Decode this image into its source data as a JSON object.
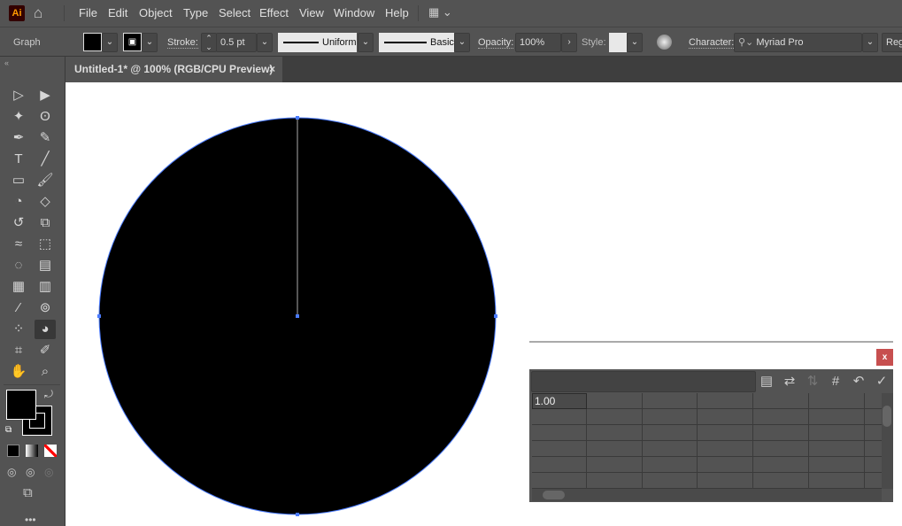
{
  "app": {
    "logo": "Ai",
    "menu": [
      "File",
      "Edit",
      "Object",
      "Type",
      "Select",
      "Effect",
      "View",
      "Window",
      "Help"
    ]
  },
  "control": {
    "selection_label": "Graph",
    "fill_color": "#000000",
    "stroke_label": "Stroke:",
    "stroke_weight": "0.5 pt",
    "profile": "Uniform",
    "brush": "Basic",
    "opacity_label": "Opacity:",
    "opacity": "100%",
    "style_label": "Style:",
    "character_label": "Character:",
    "font": "Myriad Pro",
    "font_style": "Reg"
  },
  "document": {
    "tab_title": "Untitled-1* @ 100% (RGB/CPU Preview)",
    "close": "×"
  },
  "tools": [
    [
      "selection-tool",
      "▷"
    ],
    [
      "direct-selection-tool",
      "▶"
    ],
    [
      "magic-wand-tool",
      "✦"
    ],
    [
      "lasso-tool",
      "ʘ"
    ],
    [
      "pen-tool",
      "✒"
    ],
    [
      "curvature-tool",
      "✎"
    ],
    [
      "type-tool",
      "T"
    ],
    [
      "line-segment-tool",
      "╱"
    ],
    [
      "rectangle-tool",
      "▭"
    ],
    [
      "paintbrush-tool",
      "🖌"
    ],
    [
      "shaper-tool",
      "◔"
    ],
    [
      "eraser-tool",
      "◇"
    ],
    [
      "rotate-tool",
      "↺"
    ],
    [
      "scale-tool",
      "⧉"
    ],
    [
      "warp-tool",
      "≈"
    ],
    [
      "free-transform-tool",
      "⬚"
    ],
    [
      "shape-builder-tool",
      "◌"
    ],
    [
      "perspective-grid-tool",
      "▤"
    ],
    [
      "mesh-tool",
      "▦"
    ],
    [
      "gradient-tool",
      "▥"
    ],
    [
      "eyedropper-tool",
      "⁄"
    ],
    [
      "blend-tool",
      "⊚"
    ],
    [
      "symbol-sprayer-tool",
      "⁘"
    ],
    [
      "pie-graph-tool",
      "◕"
    ],
    [
      "artboard-tool",
      "⌗"
    ],
    [
      "slice-tool",
      "✐"
    ],
    [
      "hand-tool",
      "✋"
    ],
    [
      "zoom-tool",
      "⌕"
    ]
  ],
  "graph_data": {
    "cell_value": "1.00",
    "entry": "",
    "close": "x",
    "rows": 6,
    "cols": 7
  },
  "colors": {
    "accent": "#4a7bff",
    "close_button": "#c74f4f",
    "canvas": "#ffffff",
    "ui": "#535353"
  }
}
